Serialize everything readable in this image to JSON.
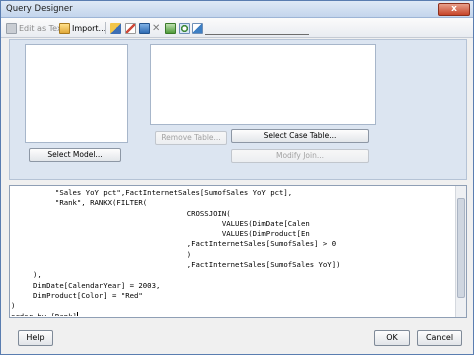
{
  "window": {
    "title": "Query Designer",
    "close_label": "x"
  },
  "toolbar": {
    "edit_as_text": "Edit as Text",
    "import": "Import..."
  },
  "designer": {
    "select_model_button": "Select Model...",
    "remove_table_button": "Remove Table...",
    "select_case_table_button": "Select Case Table...",
    "modify_join_button": "Modify Join..."
  },
  "editor": {
    "lines": [
      "          \"Sales YoY pct\",FactInternetSales[SumofSales YoY pct],",
      "          \"Rank\", RANKX(FILTER(",
      "                                        CROSSJOIN(",
      "                                                VALUES(DimDate[Calen",
      "                                                VALUES(DimProduct[En",
      "                                        ,FactInternetSales[SumofSales] > 0",
      "                                        )",
      "                                        ,FactInternetSales[SumofSales YoY])",
      "     ),",
      "     DimDate[CalendarYear] = 2003,",
      "     DimProduct[Color] = \"Red\"",
      ")",
      "order by [Rank]"
    ]
  },
  "footer": {
    "help_button": "Help",
    "ok_button": "OK",
    "cancel_button": "Cancel"
  },
  "colors": {
    "title_bar": "#c3d5ec",
    "designer_background": "#dce5f1",
    "close_button": "#c6452a"
  }
}
